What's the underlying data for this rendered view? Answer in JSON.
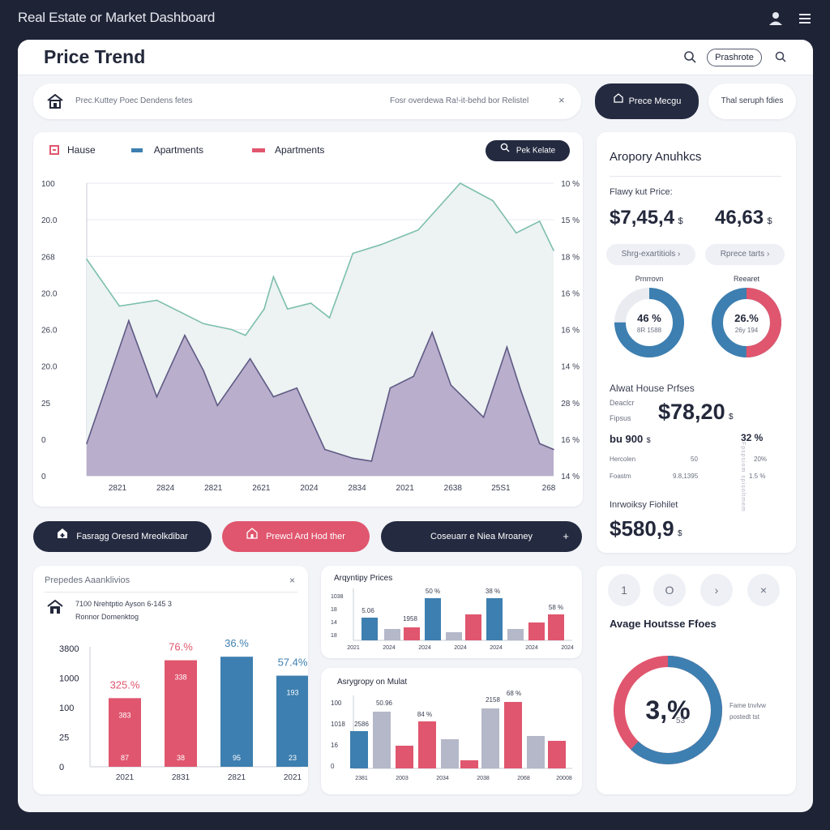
{
  "app": {
    "title": "Real Estate or Market Dashboard",
    "user_icon": "user-icon",
    "menu_icon": "menu-icon"
  },
  "header": {
    "title": "Price Trend",
    "search_icon": "search-icon",
    "button_label": "Prashrote",
    "zoom_icon": "search-icon"
  },
  "filter_bar": {
    "home_icon": "home-icon",
    "left_text": "Prec.Kuttey Poec Dendens fetes",
    "right_text": "Fosr overdewa Ra!-it-behd bor Relistel",
    "close_label": "×"
  },
  "top_buttons": {
    "dark_label": "Prece Mecgu",
    "light_label": "Thal seruph fdies"
  },
  "main_chart": {
    "search_button_label": "Pek Kelate",
    "legend": [
      {
        "label": "Hause",
        "color": "#e0566e"
      },
      {
        "label": "Apartments",
        "color": "#3d7fb0"
      },
      {
        "label": "Apartments",
        "color": "#e0566e"
      }
    ],
    "left_ticks": [
      "100",
      "20.0",
      "268",
      "20.0",
      "26.0",
      "20.0",
      "25",
      "0",
      "0"
    ],
    "right_ticks": [
      "10 %",
      "15 %",
      "18 %",
      "16 %",
      "16 %",
      "14 %",
      "28 %",
      "16 %",
      "14 %"
    ],
    "x_ticks": [
      "2821",
      "2824",
      "2821",
      "2621",
      "2024",
      "2834",
      "2021",
      "2638",
      "25S1",
      "268"
    ]
  },
  "chart_data": {
    "type": "area",
    "title": "",
    "xlabel": "",
    "ylabel": "",
    "x": [
      "2821",
      "2824",
      "2821",
      "2621",
      "2024",
      "2834",
      "2021",
      "2638",
      "25S1",
      "268"
    ],
    "ylim": [
      0,
      100
    ],
    "series": [
      {
        "name": "Apartments",
        "color": "#7cbfad",
        "fill": "#edf2f2",
        "x": [
          0,
          0.07,
          0.15,
          0.25,
          0.31,
          0.34,
          0.38,
          0.4,
          0.43,
          0.48,
          0.52,
          0.57,
          0.63,
          0.71,
          0.8,
          0.87,
          0.92,
          0.97,
          1.0
        ],
        "values": [
          74,
          58,
          60,
          52,
          50,
          48,
          57,
          68,
          57,
          59,
          54,
          76,
          79,
          84,
          100,
          94,
          83,
          87,
          77
        ]
      },
      {
        "name": "Hause",
        "color": "#5e5a85",
        "fill": "#b9aecb",
        "x": [
          0,
          0.09,
          0.15,
          0.21,
          0.25,
          0.28,
          0.35,
          0.4,
          0.45,
          0.51,
          0.57,
          0.61,
          0.65,
          0.7,
          0.74,
          0.78,
          0.85,
          0.9,
          0.93,
          0.97,
          1.0
        ],
        "values": [
          11,
          53,
          27,
          48,
          36,
          24,
          40,
          27,
          30,
          9,
          6,
          5,
          30,
          34,
          49,
          31,
          20,
          44,
          29,
          11,
          9
        ]
      }
    ]
  },
  "analytics": {
    "title": "Aropory Anuhkcs",
    "subtitle": "Flawy kut Price:",
    "value_left": "$7,45,4",
    "value_left_unit": "$",
    "value_right": "46,63",
    "value_right_unit": "$",
    "pill_left": "Shrg-exartitiols ›",
    "pill_right": "Rprece tarts ›",
    "donut_left": {
      "label": "Prnrrovn",
      "pct": "46 %",
      "sub": "8R 1588",
      "fraction": 0.75,
      "color": "#3d7fb0"
    },
    "donut_right": {
      "label": "Reearet",
      "pct": "26.%",
      "sub": "26y 194",
      "fraction": 0.5,
      "color": "#e0566e",
      "color2": "#3d7fb0"
    },
    "house_title": "Alwat House Prfses",
    "house_label_1": "Deaclcr",
    "house_label_2": "Fipsus",
    "house_value": "$78,20",
    "house_value_unit": "$",
    "row1_left": "bu 900",
    "row1_unit": "$",
    "row1_right": "32 %",
    "row2_left": "Hercolen",
    "row2_mid": "50",
    "row2_right": "20%",
    "row3_left": "Foastm",
    "row3_mid": "9.8,1395",
    "row3_right": "1.5 %",
    "side_text": "Fpspsiom spisoltmem",
    "invest_title": "Inrwoiksy Fiohilet",
    "invest_value": "$580,9",
    "invest_unit": "$"
  },
  "action_buttons": {
    "btn1_label": "Fasragg Oresrd Mreolkdibar",
    "btn2_label": "Prewcl Ard Hod ther",
    "btn3_label": "Coseuarr e Niea Mroaney",
    "btn3_arrow": "+"
  },
  "bottom_left": {
    "title": "Prepedes Aaanklivios",
    "close": "×",
    "info_line1": "7100 Nrehtptio Ayson 6-145 3",
    "info_line2": "Ronnor Domenktog",
    "y_ticks": [
      "3800",
      "1000",
      "100",
      "25",
      "0"
    ],
    "x_ticks": [
      "2021",
      "2831",
      "2821",
      "2021"
    ]
  },
  "bottom_left_chart": {
    "type": "bar",
    "categories": [
      "2021",
      "2831",
      "2821",
      "2021"
    ],
    "values": [
      58,
      90,
      93,
      77
    ],
    "colors": [
      "#e0566e",
      "#e0566e",
      "#3d7fb0",
      "#3d7fb0"
    ],
    "top_labels": [
      "325.%",
      "76.%",
      "36.%",
      "57.4%"
    ],
    "top_label_colors": [
      "#e0566e",
      "#e0566e",
      "#3d7fb0",
      "#3d7fb0"
    ],
    "mid_labels": [
      "383",
      "338",
      "",
      "193"
    ],
    "bottom_labels": [
      "87",
      "38",
      "95",
      "23"
    ]
  },
  "mid_chart_top": {
    "title": "Arqyntipy Prices",
    "y_ticks": [
      "1038",
      "18",
      "14",
      "18"
    ],
    "x_ticks": [
      "2021",
      "2024",
      "2024",
      "2024",
      "2024",
      "2024",
      "2024"
    ],
    "annotations": [
      "5.06",
      "50 %",
      "1958",
      "38 %",
      "58 %"
    ]
  },
  "mid_chart_bottom": {
    "title": "Asrygropy on Mulat",
    "y_ticks": [
      "100",
      "1018",
      "16",
      "0"
    ],
    "x_ticks": [
      "2381",
      "2003",
      "2034",
      "2038",
      "2068",
      "20008"
    ],
    "annotations": [
      "2586",
      "50.96",
      "84 %",
      "2158",
      "68 %"
    ]
  },
  "side_bottom": {
    "btn1": "1",
    "btn2": "O",
    "btn3": "›",
    "btn4": "×",
    "title": "Avage Houtsse Ffoes",
    "donut_pct": "3,%",
    "donut_sub": "53",
    "donut_fraction": 0.62,
    "donut_color": "#3d7fb0",
    "donut_color2": "#e0566e",
    "legend_line1": "Fame tnvlvw",
    "legend_line2": "postedt tst"
  }
}
